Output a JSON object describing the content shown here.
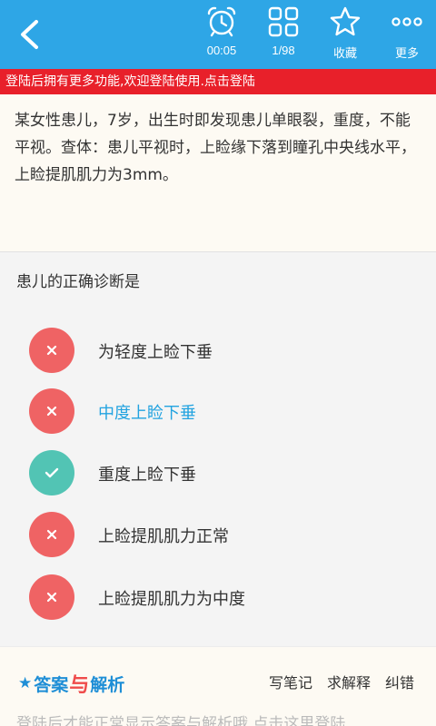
{
  "toolbar": {
    "timer": "00:05",
    "progress": "1/98",
    "favorite": "收藏",
    "more": "更多"
  },
  "login_banner": "登陆后拥有更多功能,欢迎登陆使用.点击登陆",
  "stem": "某女性患儿，7岁，出生时即发现患儿单眼裂，重度，不能平视。查体：患儿平视时，上睑缘下落到瞳孔中央线水平，上睑提肌肌力为3mm。",
  "question": "患儿的正确诊断是",
  "options": [
    {
      "text": "为轻度上睑下垂",
      "status": "wrong",
      "icon": "close-icon"
    },
    {
      "text": "中度上睑下垂",
      "status": "wrong",
      "icon": "close-icon",
      "selected": true
    },
    {
      "text": "重度上睑下垂",
      "status": "correct",
      "icon": "check-icon"
    },
    {
      "text": "上睑提肌肌力正常",
      "status": "wrong",
      "icon": "close-icon"
    },
    {
      "text": "上睑提肌肌力为中度",
      "status": "wrong",
      "icon": "close-icon"
    }
  ],
  "footer": {
    "brand_part1": "答案",
    "brand_connector": "与",
    "brand_part2": "解析",
    "write_note": "写笔记",
    "ask_explain": "求解释",
    "report_error": "纠错",
    "notice": "登陆后才能正常显示答案与解析哦,点击这里登陆"
  },
  "colors": {
    "topbar": "#2ea6e6",
    "login_banner": "#e8202a",
    "wrong": "#ef6364",
    "correct": "#52c4b4",
    "selected_text": "#22a3e0"
  }
}
